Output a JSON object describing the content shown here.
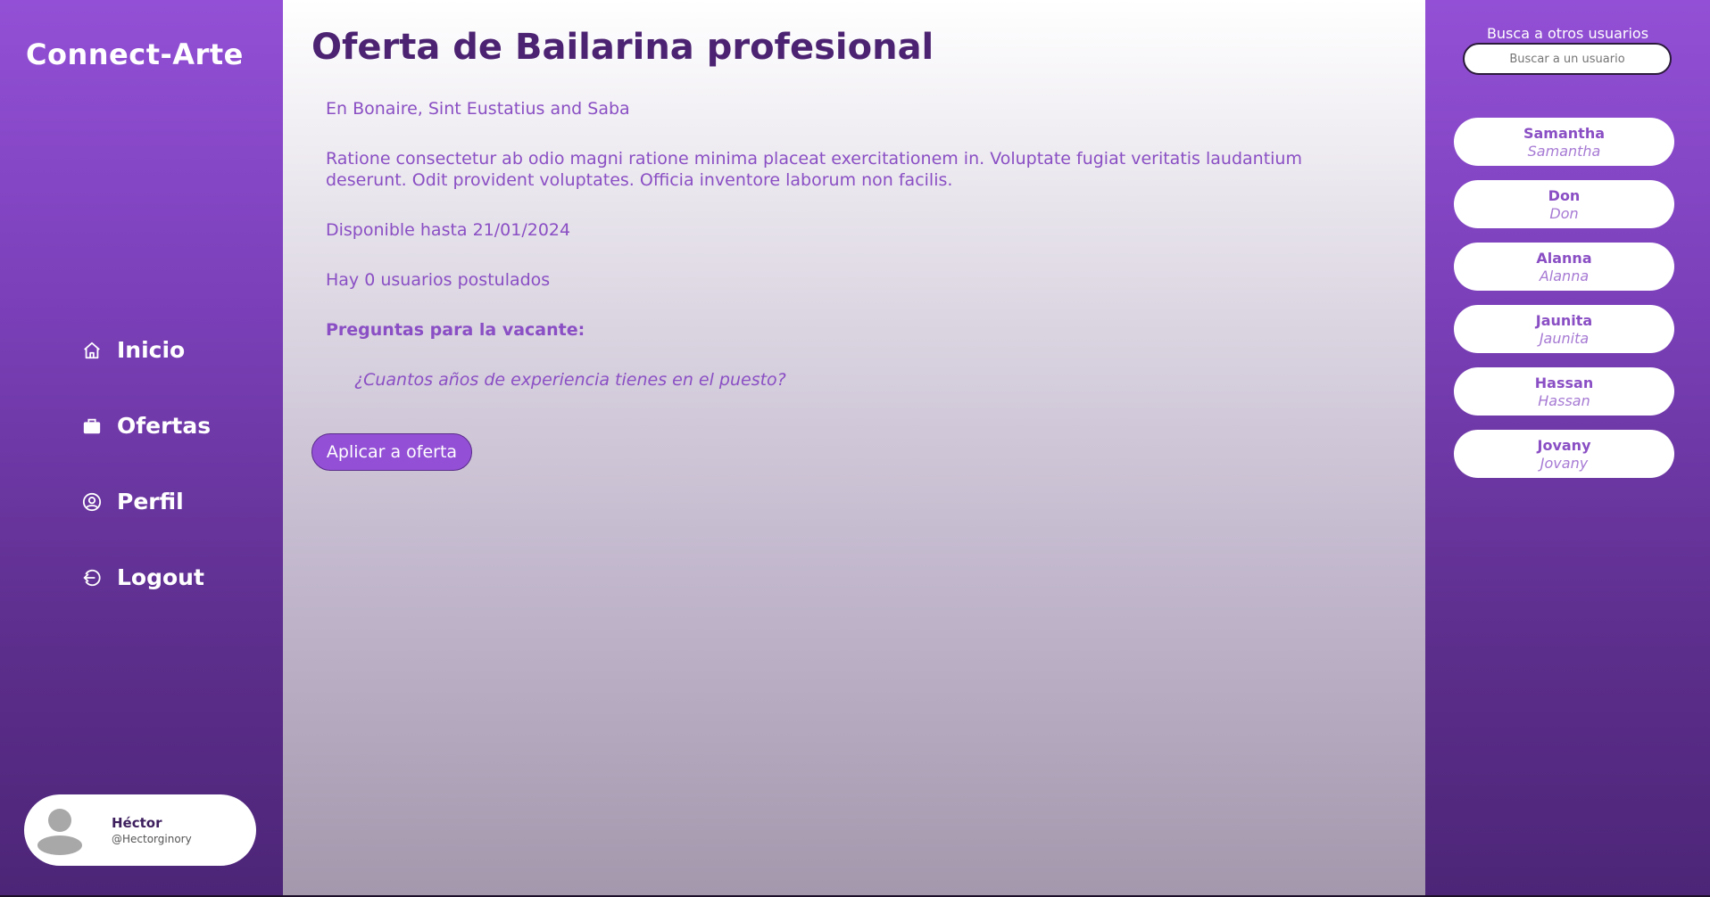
{
  "brand": "Connect-Arte",
  "nav": [
    {
      "label": "Inicio",
      "icon": "home-icon"
    },
    {
      "label": "Ofertas",
      "icon": "briefcase-icon"
    },
    {
      "label": "Perfil",
      "icon": "user-circle-icon"
    },
    {
      "label": "Logout",
      "icon": "logout-icon"
    }
  ],
  "current_user": {
    "name": "Héctor",
    "handle": "@Hectorginory"
  },
  "offer": {
    "title": "Oferta de Bailarina profesional",
    "location": "En Bonaire, Sint Eustatius and Saba",
    "description": "Ratione consectetur ab odio magni ratione minima placeat exercitationem in. Voluptate fugiat veritatis laudantium deserunt. Odit provident voluptates. Officia inventore laborum non facilis.",
    "available_until": "Disponible hasta 21/01/2024",
    "applicants": "Hay 0 usuarios postulados",
    "questions_title": "Preguntas para la vacante:",
    "questions": [
      "¿Cuantos años de experiencia tienes en el puesto?"
    ],
    "apply_label": "Aplicar a oferta"
  },
  "search": {
    "title": "Busca a otros usuarios",
    "placeholder": "Buscar a un usuario"
  },
  "users": [
    {
      "name": "Samantha",
      "username": "Samantha"
    },
    {
      "name": "Don",
      "username": "Don"
    },
    {
      "name": "Alanna",
      "username": "Alanna"
    },
    {
      "name": "Jaunita",
      "username": "Jaunita"
    },
    {
      "name": "Hassan",
      "username": "Hassan"
    },
    {
      "name": "Jovany",
      "username": "Jovany"
    }
  ],
  "colors": {
    "accent": "#9350d6",
    "title": "#4c2372",
    "text": "#8a4fc4"
  }
}
